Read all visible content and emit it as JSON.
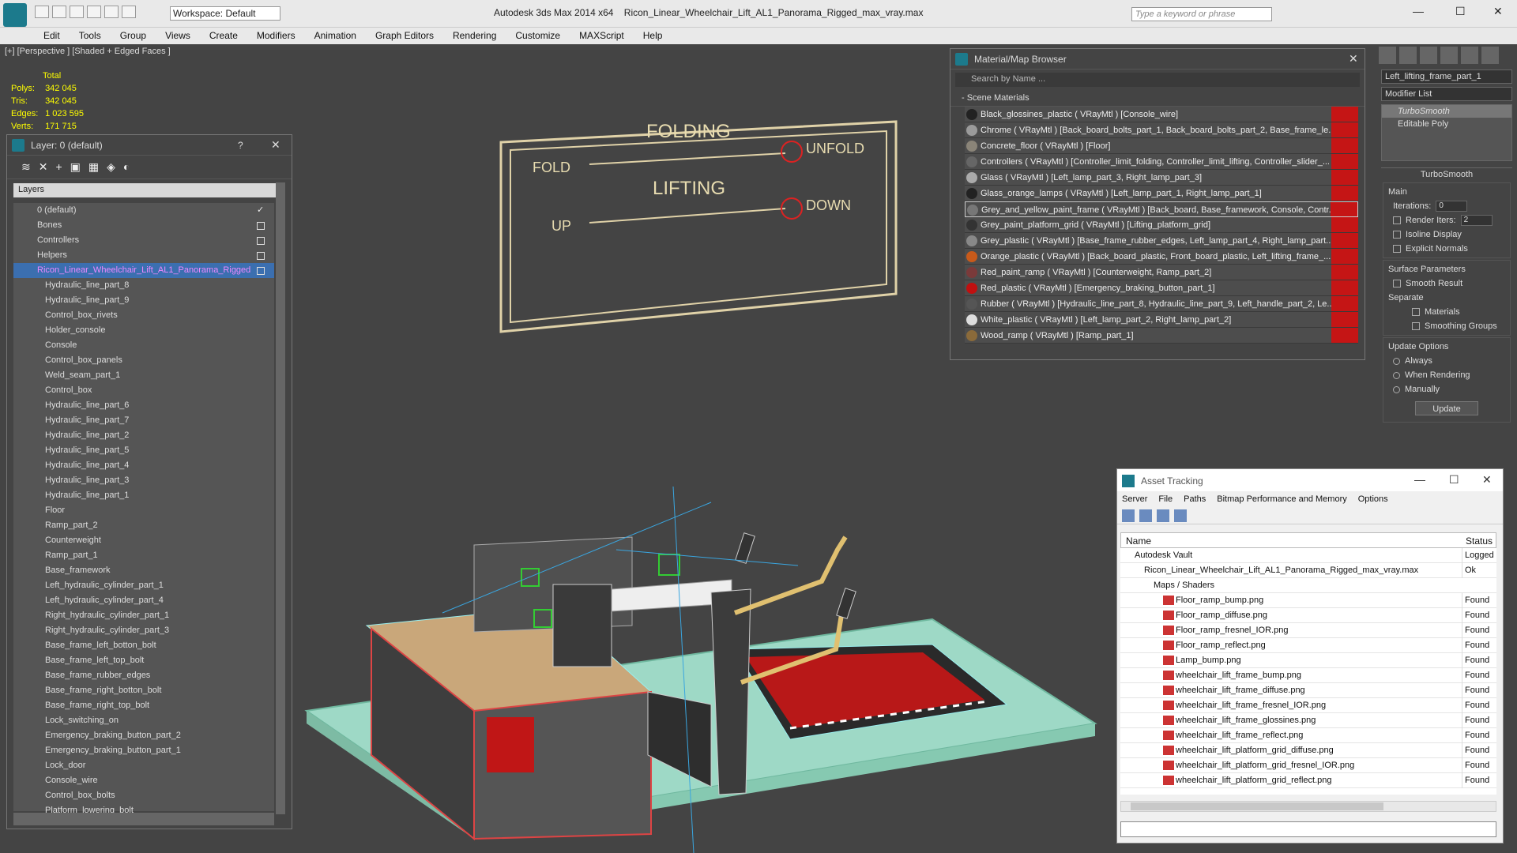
{
  "app": {
    "title": "Autodesk 3ds Max  2014 x64",
    "file": "Ricon_Linear_Wheelchair_Lift_AL1_Panorama_Rigged_max_vray.max",
    "workspace": "Workspace: Default",
    "search_placeholder": "Type a keyword or phrase"
  },
  "menu": [
    "Edit",
    "Tools",
    "Group",
    "Views",
    "Create",
    "Modifiers",
    "Animation",
    "Graph Editors",
    "Rendering",
    "Customize",
    "MAXScript",
    "Help"
  ],
  "viewport": {
    "label": "[+] [Perspective ] [Shaded + Edged Faces ]",
    "sign": {
      "title1": "FOLDING",
      "title2": "LIFTING",
      "fold": "FOLD",
      "unfold": "UNFOLD",
      "up": "UP",
      "down": "DOWN"
    }
  },
  "stats": {
    "header": "Total",
    "rows": [
      {
        "label": "Polys:",
        "value": "342 045"
      },
      {
        "label": "Tris:",
        "value": "342 045"
      },
      {
        "label": "Edges:",
        "value": "1 023 595"
      },
      {
        "label": "Verts:",
        "value": "171 715"
      }
    ]
  },
  "layer_panel": {
    "title": "Layer: 0 (default)",
    "help": "?",
    "column": "Layers",
    "top_rows": [
      "0 (default)",
      "Bones",
      "Controllers",
      "Helpers",
      "Ricon_Linear_Wheelchair_Lift_AL1_Panorama_Rigged"
    ],
    "objects": [
      "Hydraulic_line_part_8",
      "Hydraulic_line_part_9",
      "Control_box_rivets",
      "Holder_console",
      "Console",
      "Control_box_panels",
      "Weld_seam_part_1",
      "Control_box",
      "Hydraulic_line_part_6",
      "Hydraulic_line_part_7",
      "Hydraulic_line_part_2",
      "Hydraulic_line_part_5",
      "Hydraulic_line_part_4",
      "Hydraulic_line_part_3",
      "Hydraulic_line_part_1",
      "Floor",
      "Ramp_part_2",
      "Counterweight",
      "Ramp_part_1",
      "Base_framework",
      "Left_hydraulic_cylinder_part_1",
      "Left_hydraulic_cylinder_part_4",
      "Right_hydraulic_cylinder_part_1",
      "Right_hydraulic_cylinder_part_3",
      "Base_frame_left_botton_bolt",
      "Base_frame_left_top_bolt",
      "Base_frame_rubber_edges",
      "Base_frame_right_botton_bolt",
      "Base_frame_right_top_bolt",
      "Lock_switching_on",
      "Emergency_braking_button_part_2",
      "Emergency_braking_button_part_1",
      "Lock_door",
      "Console_wire",
      "Control_box_bolts",
      "Platform_lowering_bolt"
    ]
  },
  "material_browser": {
    "title": "Material/Map Browser",
    "search": "Search by Name ...",
    "section": "- Scene Materials",
    "items": [
      {
        "text": "Black_glossines_plastic ( VRayMtl ) [Console_wire]",
        "color": "#222222"
      },
      {
        "text": "Chrome ( VRayMtl ) [Back_board_bolts_part_1, Back_board_bolts_part_2, Base_frame_le...",
        "color": "#9a9a9a"
      },
      {
        "text": "Concrete_floor ( VRayMtl ) [Floor]",
        "color": "#8a8478"
      },
      {
        "text": "Controllers ( VRayMtl ) [Controller_limit_folding, Controller_limit_lifting, Controller_slider_...",
        "color": "#666666"
      },
      {
        "text": "Glass ( VRayMtl ) [Left_lamp_part_3, Right_lamp_part_3]",
        "color": "#aaaaaa"
      },
      {
        "text": "Glass_orange_lamps ( VRayMtl ) [Left_lamp_part_1, Right_lamp_part_1]",
        "color": "#222222"
      },
      {
        "text": "Grey_and_yellow_paint_frame ( VRayMtl ) [Back_board, Base_framework, Console, Contr...",
        "color": "#777777"
      },
      {
        "text": "Grey_paint_platform_grid ( VRayMtl ) [Lifting_platform_grid]",
        "color": "#333333"
      },
      {
        "text": "Grey_plastic ( VRayMtl ) [Base_frame_rubber_edges, Left_lamp_part_4, Right_lamp_part...",
        "color": "#888888"
      },
      {
        "text": "Orange_plastic ( VRayMtl ) [Back_board_plastic, Front_board_plastic, Left_lifting_frame_...",
        "color": "#c85a1a"
      },
      {
        "text": "Red_paint_ramp ( VRayMtl ) [Counterweight, Ramp_part_2]",
        "color": "#7a3a3a"
      },
      {
        "text": "Red_plastic ( VRayMtl ) [Emergency_braking_button_part_1]",
        "color": "#c01010"
      },
      {
        "text": "Rubber ( VRayMtl ) [Hydraulic_line_part_8, Hydraulic_line_part_9, Left_handle_part_2, Le...",
        "color": "#555555"
      },
      {
        "text": "White_plastic ( VRayMtl ) [Left_lamp_part_2, Right_lamp_part_2]",
        "color": "#dddddd"
      },
      {
        "text": "Wood_ramp ( VRayMtl ) [Ramp_part_1]",
        "color": "#8a6a3a"
      }
    ]
  },
  "command_panel": {
    "object_name": "Left_lifting_frame_part_1",
    "modifier_list": "Modifier List",
    "stack": [
      "TurboSmooth",
      "Editable Poly"
    ],
    "rollout": "TurboSmooth",
    "main": "Main",
    "iterations_label": "Iterations:",
    "iterations_value": "0",
    "render_iters_label": "Render Iters:",
    "render_iters_value": "2",
    "isoline": "Isoline Display",
    "explicit": "Explicit Normals",
    "surface": "Surface Parameters",
    "smooth": "Smooth Result",
    "separate": "Separate",
    "materials": "Materials",
    "smoothing": "Smoothing Groups",
    "update_options": "Update Options",
    "always": "Always",
    "when_rendering": "When Rendering",
    "manually": "Manually",
    "update_btn": "Update"
  },
  "asset_tracking": {
    "title": "Asset Tracking",
    "menu": [
      "Server",
      "File",
      "Paths",
      "Bitmap Performance and Memory",
      "Options"
    ],
    "col_name": "Name",
    "col_status": "Status",
    "rows": [
      {
        "name": "Autodesk Vault",
        "status": "Logged O",
        "indent": 1
      },
      {
        "name": "Ricon_Linear_Wheelchair_Lift_AL1_Panorama_Rigged_max_vray.max",
        "status": "Ok",
        "indent": 2
      },
      {
        "name": "Maps / Shaders",
        "status": "",
        "indent": 3
      },
      {
        "name": "Floor_ramp_bump.png",
        "status": "Found",
        "indent": 4
      },
      {
        "name": "Floor_ramp_diffuse.png",
        "status": "Found",
        "indent": 4
      },
      {
        "name": "Floor_ramp_fresnel_IOR.png",
        "status": "Found",
        "indent": 4
      },
      {
        "name": "Floor_ramp_reflect.png",
        "status": "Found",
        "indent": 4
      },
      {
        "name": "Lamp_bump.png",
        "status": "Found",
        "indent": 4
      },
      {
        "name": "wheelchair_lift_frame_bump.png",
        "status": "Found",
        "indent": 4
      },
      {
        "name": "wheelchair_lift_frame_diffuse.png",
        "status": "Found",
        "indent": 4
      },
      {
        "name": "wheelchair_lift_frame_fresnel_IOR.png",
        "status": "Found",
        "indent": 4
      },
      {
        "name": "wheelchair_lift_frame_glossines.png",
        "status": "Found",
        "indent": 4
      },
      {
        "name": "wheelchair_lift_frame_reflect.png",
        "status": "Found",
        "indent": 4
      },
      {
        "name": "wheelchair_lift_platform_grid_diffuse.png",
        "status": "Found",
        "indent": 4
      },
      {
        "name": "wheelchair_lift_platform_grid_fresnel_IOR.png",
        "status": "Found",
        "indent": 4
      },
      {
        "name": "wheelchair_lift_platform_grid_reflect.png",
        "status": "Found",
        "indent": 4
      }
    ]
  }
}
